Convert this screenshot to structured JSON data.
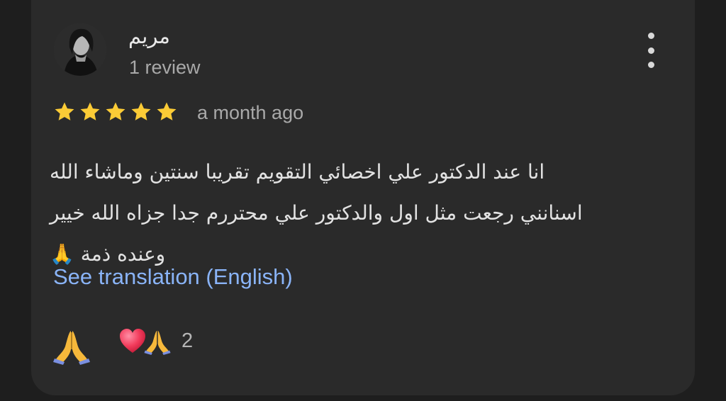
{
  "review": {
    "author_name": "مريم",
    "author_meta": "1 review",
    "rating": 5,
    "rating_max": 5,
    "time_ago": "a month ago",
    "text_lines": [
      "انا عند الدكتور علي اخصائي التقويم تقريبا سنتين وماشاء الله",
      "اسنانني رجعت مثل اول والدكتور علي محتررم جدا جزاه الله خيير",
      "وعنده ذمة 🙏"
    ],
    "translate_link": "See translation (English)",
    "reactions": {
      "my_reaction_icon": "folded-hands-icon",
      "summary_icons": [
        "heart-icon",
        "folded-hands-icon"
      ],
      "count": "2"
    },
    "colors": {
      "card": "#2a2a2a",
      "star": "#fbcb36",
      "link": "#8ab4f8"
    }
  }
}
